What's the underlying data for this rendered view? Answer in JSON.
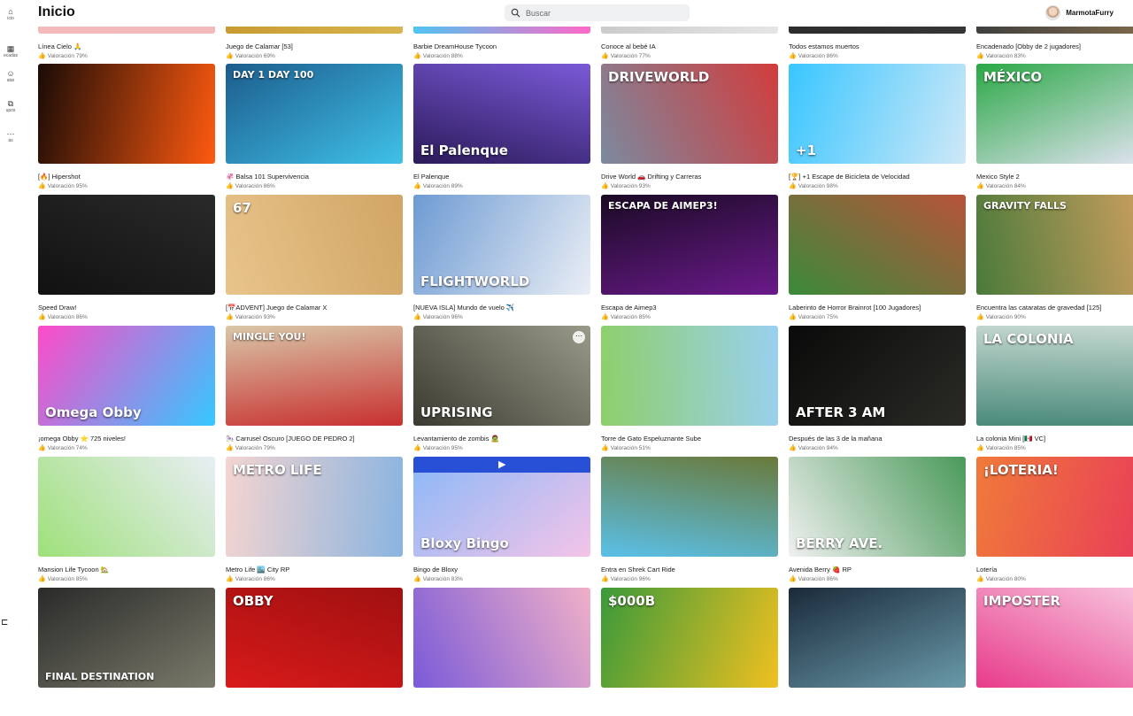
{
  "sidebar": {
    "items": [
      {
        "label": "icio",
        "icon": "home-icon",
        "glyph": "⌂"
      },
      {
        "label": "ecadas",
        "icon": "grid-icon",
        "glyph": "▦"
      },
      {
        "label": "atar",
        "icon": "avatar-icon",
        "glyph": "☺"
      },
      {
        "label": "upos",
        "icon": "groups-icon",
        "glyph": "⧉"
      },
      {
        "label": "ás",
        "icon": "more-icon",
        "glyph": "⋯"
      }
    ],
    "bottom_glyph": "⊏"
  },
  "header": {
    "title": "Inicio",
    "search_placeholder": "Buscar",
    "username": "MarmotaFurry"
  },
  "games": [
    {
      "title": "Línea Cielo 🙏",
      "rating": "Valoración 79%",
      "colors": [
        "#f4b8b8",
        "#dcdce8"
      ],
      "label": ""
    },
    {
      "title": "Juego de Calamar [53]",
      "rating": "Valoración 69%",
      "colors": [
        "#c89a32",
        "#e0c35e"
      ],
      "label": ""
    },
    {
      "title": "Barbie DreamHouse Tycoon",
      "rating": "Valoración 88%",
      "colors": [
        "#49c8f3",
        "#ff68c8"
      ],
      "label": ""
    },
    {
      "title": "Conoce al bebé IA",
      "rating": "Valoración 77%",
      "colors": [
        "#b9b9b9",
        "#e6e6e6"
      ],
      "label": ""
    },
    {
      "title": "Todos estamos muertos",
      "rating": "Valoración 86%",
      "colors": [
        "#2b2b2b",
        "#5a5a5a"
      ],
      "label": ""
    },
    {
      "title": "Encadenado [Obby de 2 jugadores]",
      "rating": "Valoración 83%",
      "colors": [
        "#3f3f3f",
        "#9a7b4f"
      ],
      "label": ""
    },
    {
      "title": "[🔥] Hipershot",
      "rating": "Valoración 95%",
      "colors": [
        "#1a0b06",
        "#ff5a10"
      ],
      "label": ""
    },
    {
      "title": "🦑 Balsa 101 Supervivencia",
      "rating": "Valoración 86%",
      "colors": [
        "#1c5c8c",
        "#3fc1e8"
      ],
      "label": "DAY 1    DAY 100"
    },
    {
      "title": "El Palenque",
      "rating": "Valoración 89%",
      "colors": [
        "#2b1a5a",
        "#7b5ad8"
      ],
      "label": "El Palenque"
    },
    {
      "title": "Drive World 🚗 Drifting y Carreras",
      "rating": "Valoración 93%",
      "colors": [
        "#7b8aa0",
        "#d23c3c"
      ],
      "label": "DRIVEWORLD"
    },
    {
      "title": "[🏆] +1 Escape de Bicicleta de Velocidad",
      "rating": "Valoración 98%",
      "colors": [
        "#39c6ff",
        "#cfe8f7"
      ],
      "label": "+1"
    },
    {
      "title": "Mexico Style 2",
      "rating": "Valoración 84%",
      "colors": [
        "#2aa845",
        "#e4e4f4"
      ],
      "label": "MÉXICO"
    },
    {
      "title": "Speed Draw!",
      "rating": "Valoración 86%",
      "colors": [
        "#111111",
        "#2a2a2a"
      ],
      "label": ""
    },
    {
      "title": "[📅ADVENT] Juego de Calamar X",
      "rating": "Valoración 93%",
      "colors": [
        "#e8c48b",
        "#d1a565"
      ],
      "label": "67"
    },
    {
      "title": "[NUEVA ISLA] Mundo de vuelo ✈️",
      "rating": "Valoración 96%",
      "colors": [
        "#6e9bd3",
        "#eaeef5"
      ],
      "label": "FLIGHTWORLD"
    },
    {
      "title": "Escapa de Aimep3",
      "rating": "Valoración 85%",
      "colors": [
        "#1a0a24",
        "#6a1a8a"
      ],
      "label": "ESCAPA DE AIMEP3!"
    },
    {
      "title": "Laberinto de Horror Brainrot [100 Jugadores]",
      "rating": "Valoración 75%",
      "colors": [
        "#3a8a3a",
        "#b8533a"
      ],
      "label": ""
    },
    {
      "title": "Encuentra las cataratas de gravedad [125]",
      "rating": "Valoración 90%",
      "colors": [
        "#4a7a3a",
        "#d0a060"
      ],
      "label": "GRAVITY FALLS"
    },
    {
      "title": "¡omega Obby ⭐ 725 niveles!",
      "rating": "Valoración 74%",
      "colors": [
        "#ff4ac8",
        "#34c8ff"
      ],
      "label": "Omega Obby"
    },
    {
      "title": "🎠 Carrusel Oscuro [JUEGO DE PEDRO 2]",
      "rating": "Valoración 79%",
      "colors": [
        "#d9c7a8",
        "#c83030"
      ],
      "label": "MINGLE   YOU!"
    },
    {
      "title": "Levantamiento de zombis 🧟",
      "rating": "Valoración 95%",
      "colors": [
        "#3a3a30",
        "#9a9a8a"
      ],
      "label": "UPRISING"
    },
    {
      "title": "Torre de Gato Espeluznante Sube",
      "rating": "Valoración 51%",
      "colors": [
        "#8ecf6a",
        "#9ad0f0"
      ],
      "label": ""
    },
    {
      "title": "Después de las 3 de la mañana",
      "rating": "Valoración 94%",
      "colors": [
        "#0a0a0a",
        "#2a2a26"
      ],
      "label": "AFTER 3 AM"
    },
    {
      "title": "La colonia Mini [🇲🇽 VC]",
      "rating": "Valoración 85%",
      "colors": [
        "#4a8a7a",
        "#c4d8d0"
      ],
      "label": "LA COLONIA"
    },
    {
      "title": "Mansion Life Tycoon 🏡",
      "rating": "Valoración 85%",
      "colors": [
        "#9ee07a",
        "#e8eef4"
      ],
      "label": ""
    },
    {
      "title": "Metro Life 🏙️ City RP",
      "rating": "Valoración 86%",
      "colors": [
        "#f4d4d0",
        "#8ab4e0"
      ],
      "label": "METRO LIFE"
    },
    {
      "title": "Bingo de Bloxy",
      "rating": "Valoración 83%",
      "colors": [
        "#8ab8f8",
        "#f4c4e8"
      ],
      "label": "Bloxy Bingo"
    },
    {
      "title": "Entra en Shrek Cart Ride",
      "rating": "Valoración 96%",
      "colors": [
        "#5ac0e8",
        "#6a7a3a"
      ],
      "label": ""
    },
    {
      "title": "Avenida Berry 🍓 RP",
      "rating": "Valoración 86%",
      "colors": [
        "#f0f0f0",
        "#4a9a5a"
      ],
      "label": "BERRY AVE."
    },
    {
      "title": "Lotería",
      "rating": "Valoración 80%",
      "colors": [
        "#f07a3a",
        "#e83a5a"
      ],
      "label": "¡LOTERIA!"
    },
    {
      "title": "",
      "rating": "",
      "colors": [
        "#2a2a2a",
        "#7a7a6a"
      ],
      "label": "FINAL DESTINATION"
    },
    {
      "title": "",
      "rating": "",
      "colors": [
        "#d81a1a",
        "#a01010"
      ],
      "label": "OBBY"
    },
    {
      "title": "",
      "rating": "",
      "colors": [
        "#7a5ad8",
        "#f0b0c8"
      ],
      "label": ""
    },
    {
      "title": "",
      "rating": "",
      "colors": [
        "#3a9a3a",
        "#f0c020"
      ],
      "label": "$000B"
    },
    {
      "title": "",
      "rating": "",
      "colors": [
        "#1a2a3a",
        "#6a9aaa"
      ],
      "label": ""
    },
    {
      "title": "",
      "rating": "",
      "colors": [
        "#e83a8a",
        "#f8c8e0"
      ],
      "label": "IMPOSTER"
    }
  ]
}
